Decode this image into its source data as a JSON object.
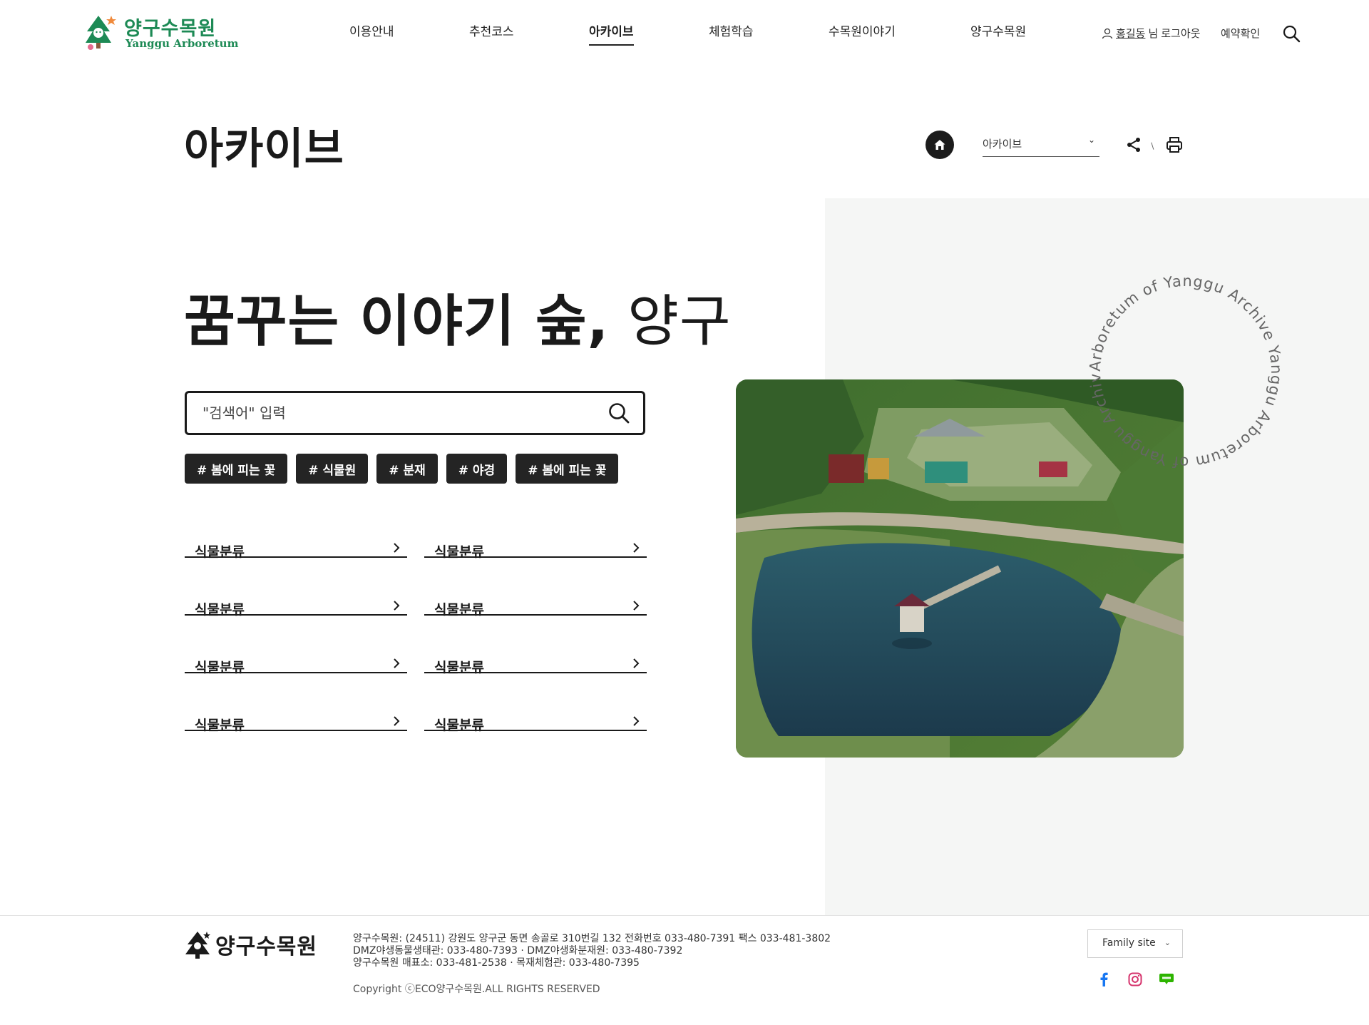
{
  "header": {
    "logo_ko": "양구수목원",
    "logo_en": "Yanggu Arboretum",
    "nav": [
      {
        "label": "이용안내"
      },
      {
        "label": "추천코스"
      },
      {
        "label": "아카이브"
      },
      {
        "label": "체험학습"
      },
      {
        "label": "수목원이야기"
      },
      {
        "label": "양구수목원"
      }
    ],
    "active_nav": "아카이브",
    "user_name": "홍길동",
    "user_suffix": "님",
    "logout_label": "로그아웃",
    "reserve_label": "예약확인",
    "icons": [
      "user-icon",
      "search-icon"
    ]
  },
  "page": {
    "title": "아카이브",
    "location_select": "아카이브",
    "icons": [
      "home-icon",
      "share-icon",
      "print-icon"
    ]
  },
  "hero": {
    "title_strong": "꿈꾸는 이야기 숲,",
    "title_light": "양구",
    "search_placeholder": "\"검색어\" 입력",
    "tags": [
      "# 봄에 피는 꽃",
      "# 식물원",
      "# 분재",
      "# 야경",
      "# 봄에 피는 꽃"
    ],
    "categories": [
      "식물분류",
      "식물분류",
      "식물분류",
      "식물분류",
      "식물분류",
      "식물분류",
      "식물분류",
      "식물분류"
    ],
    "circle_text": "Arboretum of Yanggu Archive Yanggu Arboretum of Yanggu Archive"
  },
  "footer": {
    "logo": "양구수목원",
    "address_line1": "양구수목원: (24511) 강원도 양구군 동면 송골로 310번길 132 전화번호 033-480-7391 팩스 033-481-3802",
    "address_line2": "DMZ야생동물생태관: 033-480-7393 · DMZ야생화분재원: 033-480-7392",
    "address_line3": "양구수목원 매표소: 033-481-2538 · 목재체험관: 033-480-7395",
    "copyright": "Copyright ⓒECO양구수목원.ALL RIGHTS RESERVED",
    "family_site": "Family site",
    "sns": [
      "facebook-icon",
      "instagram-icon",
      "blog-icon"
    ]
  },
  "colors": {
    "brand_green": "#1d8a55",
    "dark": "#1a1a1a",
    "panel_gray": "#f5f6f5"
  }
}
